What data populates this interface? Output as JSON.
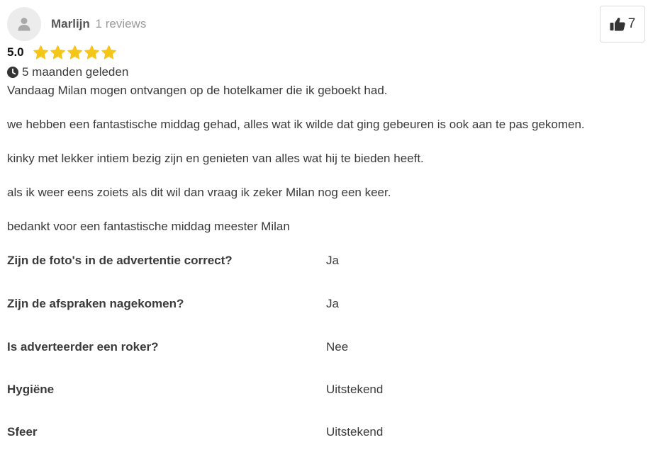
{
  "reviewer": {
    "name": "Marlijn",
    "review_count": "1 reviews",
    "avatar_icon": "user-icon"
  },
  "likes": {
    "count": "7",
    "icon": "thumbs-up-icon"
  },
  "rating": {
    "value": "5.0",
    "stars": 5,
    "max_stars": 5,
    "star_color": "#f5c518"
  },
  "date": {
    "icon": "clock-icon",
    "text": "5 maanden geleden"
  },
  "paragraphs": [
    "Vandaag Milan mogen ontvangen op de hotelkamer die ik geboekt had.",
    "we hebben een fantastische middag gehad, alles wat ik wilde dat ging gebeuren is ook aan te pas gekomen.",
    "kinky met lekker intiem bezig zijn en genieten van alles wat hij te bieden heeft.",
    "als ik weer eens zoiets als dit wil dan vraag ik zeker Milan nog een keer.",
    "bedankt voor een fantastische middag meester Milan"
  ],
  "questions": [
    {
      "q": "Zijn de foto's in de advertentie correct?",
      "a": "Ja"
    },
    {
      "q": "Zijn de afspraken nagekomen?",
      "a": "Ja"
    },
    {
      "q": "Is adverteerder een roker?",
      "a": "Nee"
    },
    {
      "q": "Hygiëne",
      "a": "Uitstekend"
    },
    {
      "q": "Sfeer",
      "a": "Uitstekend"
    }
  ]
}
